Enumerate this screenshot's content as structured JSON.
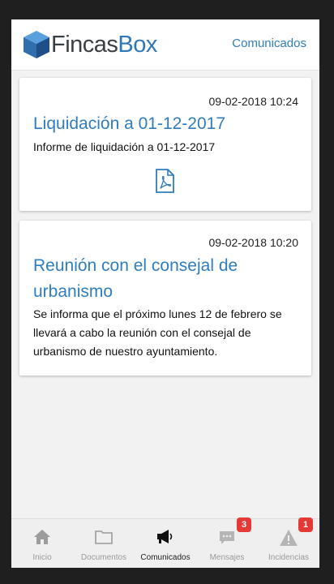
{
  "header": {
    "brand_part1": "Fincas",
    "brand_part2": "Box",
    "section_link": "Comunicados"
  },
  "cards": [
    {
      "date": "09-02-2018 10:24",
      "title": "Liquidación a 01-12-2017",
      "body": "Informe de liquidación a 01-12-2017",
      "attachment_icon": "pdf-icon"
    },
    {
      "date": "09-02-2018 10:20",
      "title_line1": "Reunión con el consejal de",
      "title_line2": "urbanismo",
      "body_line1": "Se informa que el próximo lunes 12 de febrero se",
      "body_line2": "llevará a cabo la reunión con el consejal de",
      "body_line3": "urbanismo de nuestro ayuntamiento."
    }
  ],
  "tabs": [
    {
      "label": "Inicio",
      "icon": "home-icon",
      "active": false
    },
    {
      "label": "Documentos",
      "icon": "folder-icon",
      "active": false
    },
    {
      "label": "Comunicados",
      "icon": "megaphone-icon",
      "active": true
    },
    {
      "label": "Mensajes",
      "icon": "chat-icon",
      "active": false,
      "badge": "3"
    },
    {
      "label": "Incidencias",
      "icon": "warning-icon",
      "active": false,
      "badge": "1"
    }
  ],
  "colors": {
    "accent": "#2f7dbf",
    "badge": "#e53935",
    "background": "#f2f2f2"
  }
}
